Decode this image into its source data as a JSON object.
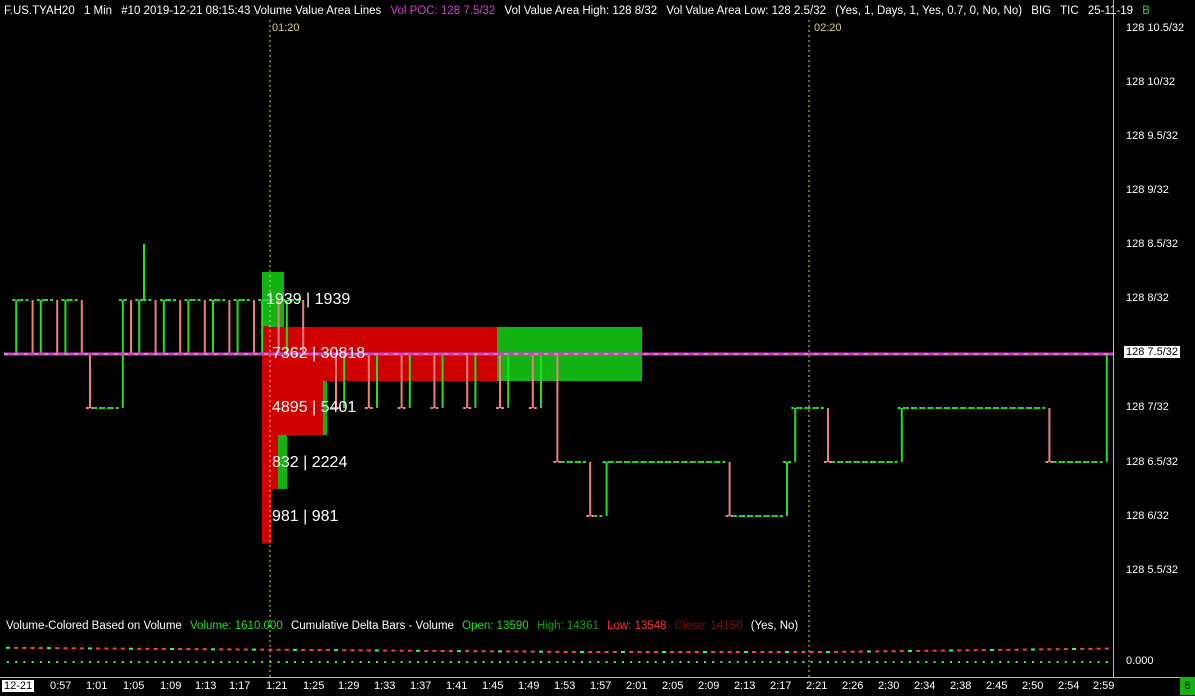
{
  "header": {
    "symbol": "F.US.TYAH20",
    "interval": "1 Min",
    "study": "#10 2019-12-21 08:15:43 Volume Value Area Lines",
    "vpoc": "Vol POC: 128 7.5/32",
    "vah": "Vol Value Area High: 128 8/32",
    "val": "Vol Value Area Low: 128 2.5/32",
    "params": "(Yes, 1, Days, 1, Yes, 0.7, 0, No, No)",
    "big": "BIG",
    "tic": "TIC",
    "date": "25-11-19",
    "trailing": "B"
  },
  "markers": [
    "01:20",
    "02:20"
  ],
  "y_axis": {
    "labels": [
      "128 10.5/32",
      "128 10/32",
      "128 9.5/32",
      "128 9/32",
      "128 8.5/32",
      "128 8/32",
      "128 7.5/32",
      "128 7/32",
      "128 6.5/32",
      "128 6/32",
      "128 5.5/32"
    ],
    "current": "128 7.5/32"
  },
  "x_axis": {
    "first": "12-21",
    "labels": [
      "0:57",
      "1:01",
      "1:05",
      "1:09",
      "1:13",
      "1:17",
      "1:21",
      "1:25",
      "1:29",
      "1:33",
      "1:37",
      "1:41",
      "1:45",
      "1:49",
      "1:53",
      "1:57",
      "2:01",
      "2:05",
      "2:09",
      "2:13",
      "2:17",
      "2:21",
      "2:26",
      "2:30",
      "2:34",
      "2:38",
      "2:45",
      "2:50",
      "2:54",
      "2:59"
    ]
  },
  "volume_profile": [
    {
      "label": "1939 | 1939",
      "level": "128 8/32"
    },
    {
      "label": "7362 | 30818",
      "level": "128 7.5/32"
    },
    {
      "label": "4895 | 5401",
      "level": "128 7/32"
    },
    {
      "label": "832 | 2224",
      "level": "128 6.5/32"
    },
    {
      "label": "981 | 981",
      "level": "128 6/32"
    }
  ],
  "lower_panel": {
    "title": "Volume-Colored Based on Volume",
    "volume": "Volume: 1610.000",
    "delta_title": "Cumulative Delta Bars - Volume",
    "open": "Open: 13590",
    "high": "High: 14361",
    "low": "Low: 13548",
    "close": "Close: 14150",
    "params": "(Yes, No)",
    "axis_value": "0.000"
  },
  "status_badge": "8",
  "colors": {
    "up": "#22e022",
    "down": "#f08080",
    "poc_line": "#d040d0",
    "marker": "#e0d27a",
    "profile_red": "#d00000",
    "profile_green": "#12b312",
    "lower_red": "#ff4040",
    "lower_green": "#40ff40"
  }
}
